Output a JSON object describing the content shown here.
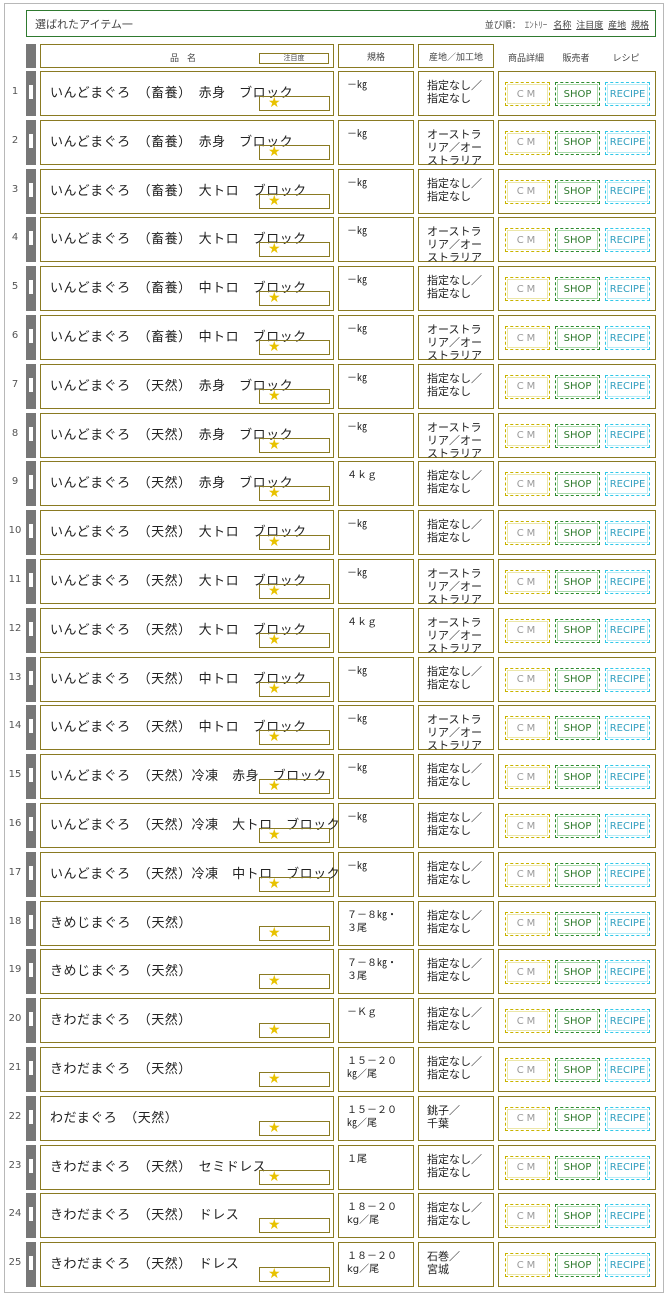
{
  "header": {
    "title": "選ばれたアイテム一",
    "sort_label": "並び順：",
    "sort_type": "ｴﾝﾄﾘｰ",
    "sort_links": [
      "名称",
      "注目度",
      "産地",
      "規格"
    ]
  },
  "columns": {
    "name": "品名",
    "attention": "注目度",
    "spec": "規格",
    "origin": "産地／加工地",
    "detail": "商品詳細",
    "seller": "販売者",
    "recipe": "レシピ"
  },
  "buttons": {
    "cm": "CM",
    "shop": "SHOP",
    "recipe": "RECIPE"
  },
  "colors": {
    "cm": "#c9b400",
    "shop": "#2e8b2e",
    "recipe": "#33c8e8",
    "star": "#e8c200",
    "border": "#8a7a22"
  },
  "items": [
    {
      "num": "1",
      "name": "いんどまぐろ　（畜養）　赤身　ブロック",
      "spec": "－㎏",
      "origin": "指定なし／\n指定なし"
    },
    {
      "num": "2",
      "name": "いんどまぐろ　（畜養）　赤身　ブロック",
      "spec": "－㎏",
      "origin": "オーストラ\nリア／オー\nストラリア"
    },
    {
      "num": "3",
      "name": "いんどまぐろ　（畜養）　大トロ　ブロック",
      "spec": "－㎏",
      "origin": "指定なし／\n指定なし"
    },
    {
      "num": "4",
      "name": "いんどまぐろ　（畜養）　大トロ　ブロック",
      "spec": "－㎏",
      "origin": "オーストラ\nリア／オー\nストラリア"
    },
    {
      "num": "5",
      "name": "いんどまぐろ　（畜養）　中トロ　ブロック",
      "spec": "－㎏",
      "origin": "指定なし／\n指定なし"
    },
    {
      "num": "6",
      "name": "いんどまぐろ　（畜養）　中トロ　ブロック",
      "spec": "－㎏",
      "origin": "オーストラ\nリア／オー\nストラリア"
    },
    {
      "num": "7",
      "name": "いんどまぐろ　（天然）　赤身　ブロック",
      "spec": "－㎏",
      "origin": "指定なし／\n指定なし"
    },
    {
      "num": "8",
      "name": "いんどまぐろ　（天然）　赤身　ブロック",
      "spec": "－㎏",
      "origin": "オーストラ\nリア／オー\nストラリア"
    },
    {
      "num": "9",
      "name": "いんどまぐろ　（天然）　赤身　ブロック",
      "spec": "４ｋｇ",
      "origin": "指定なし／\n指定なし"
    },
    {
      "num": "10",
      "name": "いんどまぐろ　（天然）　大トロ　ブロック",
      "spec": "－㎏",
      "origin": "指定なし／\n指定なし"
    },
    {
      "num": "11",
      "name": "いんどまぐろ　（天然）　大トロ　ブロック",
      "spec": "－㎏",
      "origin": "オーストラ\nリア／オー\nストラリア"
    },
    {
      "num": "12",
      "name": "いんどまぐろ　（天然）　大トロ　ブロック",
      "spec": "４ｋｇ",
      "origin": "オーストラ\nリア／オー\nストラリア"
    },
    {
      "num": "13",
      "name": "いんどまぐろ　（天然）　中トロ　ブロック",
      "spec": "－㎏",
      "origin": "指定なし／\n指定なし"
    },
    {
      "num": "14",
      "name": "いんどまぐろ　（天然）　中トロ　ブロック",
      "spec": "－㎏",
      "origin": "オーストラ\nリア／オー\nストラリア"
    },
    {
      "num": "15",
      "name": "いんどまぐろ　（天然）冷凍　赤身　ブロック",
      "spec": "－㎏",
      "origin": "指定なし／\n指定なし"
    },
    {
      "num": "16",
      "name": "いんどまぐろ　（天然）冷凍　大トロ　ブロック",
      "spec": "－㎏",
      "origin": "指定なし／\n指定なし"
    },
    {
      "num": "17",
      "name": "いんどまぐろ　（天然）冷凍　中トロ　ブロック",
      "spec": "－㎏",
      "origin": "指定なし／\n指定なし"
    },
    {
      "num": "18",
      "name": "きめじまぐろ　（天然）",
      "spec": "７－８㎏・\n３尾",
      "origin": "指定なし／\n指定なし"
    },
    {
      "num": "19",
      "name": "きめじまぐろ　（天然）",
      "spec": "７－８㎏・\n３尾",
      "origin": "指定なし／\n指定なし"
    },
    {
      "num": "20",
      "name": "きわだまぐろ　（天然）",
      "spec": "－Ｋｇ",
      "origin": "指定なし／\n指定なし"
    },
    {
      "num": "21",
      "name": "きわだまぐろ　（天然）",
      "spec": "１５－２０\n㎏／尾",
      "origin": "指定なし／\n指定なし"
    },
    {
      "num": "22",
      "name": "わだまぐろ　（天然）",
      "spec": "１５－２０\n㎏／尾",
      "origin": "銚子／\n千葉"
    },
    {
      "num": "23",
      "name": "きわだまぐろ　（天然）　セミドレス",
      "spec": "１尾",
      "origin": "指定なし／\n指定なし"
    },
    {
      "num": "24",
      "name": "きわだまぐろ　（天然）　ドレス",
      "spec": "１８－２０\nkg／尾",
      "origin": "指定なし／\n指定なし"
    },
    {
      "num": "25",
      "name": "きわだまぐろ　（天然）　ドレス",
      "spec": "１８－２０\nkg／尾",
      "origin": "石巻／\n宮城"
    }
  ]
}
